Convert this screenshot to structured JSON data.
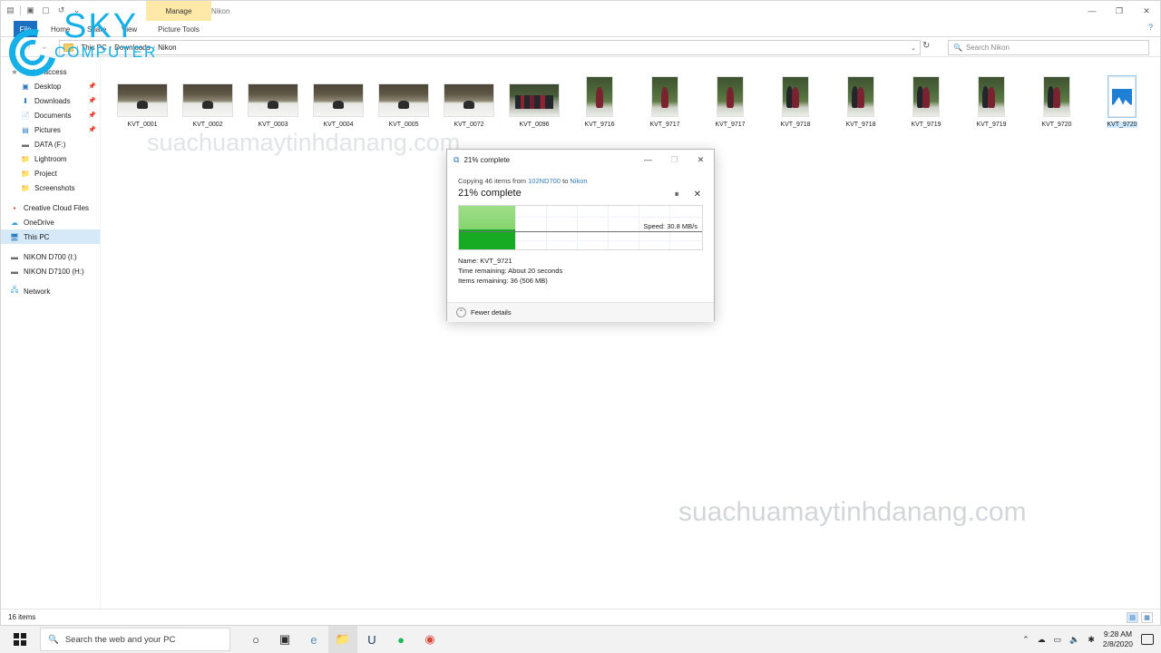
{
  "window": {
    "title": "Nikon",
    "contextual_tab": "Manage",
    "picture_tools_label": "Picture Tools",
    "quick_access_icons": [
      "explorer-icon",
      "properties-icon",
      "new-folder-icon",
      "undo-icon",
      "dropdown-icon"
    ],
    "controls": {
      "minimize": "—",
      "maximize": "❐",
      "close": "✕"
    },
    "help": "?"
  },
  "ribbon": {
    "tabs": [
      {
        "id": "file",
        "label": "File"
      },
      {
        "id": "home",
        "label": "Home"
      },
      {
        "id": "share",
        "label": "Share"
      },
      {
        "id": "view",
        "label": "View"
      },
      {
        "id": "pictools",
        "label": "Picture Tools"
      }
    ]
  },
  "address": {
    "back": "‹",
    "forward": "›",
    "up": "↑",
    "breadcrumb": [
      "This PC",
      "Downloads",
      "Nikon"
    ],
    "separator": "›",
    "dropdown": "⌄",
    "refresh": "↻"
  },
  "search": {
    "placeholder": "Search Nikon",
    "icon": "search-icon"
  },
  "sidebar": {
    "items": [
      {
        "label": "Quick access",
        "icon": "star-icon",
        "indent": 0,
        "pinned": false,
        "selected": false
      },
      {
        "label": "Desktop",
        "icon": "desktop-icon",
        "indent": 1,
        "pinned": true,
        "selected": false
      },
      {
        "label": "Downloads",
        "icon": "download-icon",
        "indent": 1,
        "pinned": true,
        "selected": false
      },
      {
        "label": "Documents",
        "icon": "document-icon",
        "indent": 1,
        "pinned": true,
        "selected": false
      },
      {
        "label": "Pictures",
        "icon": "pictures-icon",
        "indent": 1,
        "pinned": true,
        "selected": false
      },
      {
        "label": "DATA (F:)",
        "icon": "drive-icon",
        "indent": 1,
        "pinned": false,
        "selected": false
      },
      {
        "label": "Lightroom",
        "icon": "folder-icon",
        "indent": 1,
        "pinned": false,
        "selected": false
      },
      {
        "label": "Project",
        "icon": "folder-icon",
        "indent": 1,
        "pinned": false,
        "selected": false
      },
      {
        "label": "Screenshots",
        "icon": "folder-icon",
        "indent": 1,
        "pinned": false,
        "selected": false
      },
      {
        "label": "Creative Cloud Files",
        "icon": "creative-cloud-icon",
        "indent": 0,
        "pinned": false,
        "selected": false
      },
      {
        "label": "OneDrive",
        "icon": "onedrive-icon",
        "indent": 0,
        "pinned": false,
        "selected": false
      },
      {
        "label": "This PC",
        "icon": "this-pc-icon",
        "indent": 0,
        "pinned": false,
        "selected": true
      },
      {
        "label": "NIKON D700 (I:)",
        "icon": "drive-icon",
        "indent": 0,
        "pinned": false,
        "selected": false
      },
      {
        "label": "NIKON D7100 (H:)",
        "icon": "drive-icon",
        "indent": 0,
        "pinned": false,
        "selected": false
      },
      {
        "label": "Network",
        "icon": "network-icon",
        "indent": 0,
        "pinned": false,
        "selected": false
      }
    ]
  },
  "files": [
    {
      "name": "KVT_0001",
      "kind": "snow",
      "orient": "land",
      "selected": false
    },
    {
      "name": "KVT_0002",
      "kind": "snow",
      "orient": "land",
      "selected": false
    },
    {
      "name": "KVT_0003",
      "kind": "snow",
      "orient": "land",
      "selected": false
    },
    {
      "name": "KVT_0004",
      "kind": "snow",
      "orient": "land",
      "selected": false
    },
    {
      "name": "KVT_0005",
      "kind": "snow",
      "orient": "land",
      "selected": false
    },
    {
      "name": "KVT_0072",
      "kind": "snow",
      "orient": "land",
      "selected": false
    },
    {
      "name": "KVT_0096",
      "kind": "group",
      "orient": "land",
      "selected": false
    },
    {
      "name": "KVT_9716",
      "kind": "green",
      "orient": "port",
      "selected": false
    },
    {
      "name": "KVT_9717",
      "kind": "green",
      "orient": "port",
      "selected": false
    },
    {
      "name": "KVT_9717",
      "kind": "green",
      "orient": "port",
      "selected": false
    },
    {
      "name": "KVT_9718",
      "kind": "green2",
      "orient": "port",
      "selected": false
    },
    {
      "name": "KVT_9718",
      "kind": "green2",
      "orient": "port",
      "selected": false
    },
    {
      "name": "KVT_9719",
      "kind": "green2",
      "orient": "port",
      "selected": false
    },
    {
      "name": "KVT_9719",
      "kind": "green2",
      "orient": "port",
      "selected": false
    },
    {
      "name": "KVT_9720",
      "kind": "green2",
      "orient": "port",
      "selected": false
    },
    {
      "name": "KVT_9720",
      "kind": "placeholder",
      "orient": "port",
      "selected": true
    }
  ],
  "status": {
    "items_count": "16 items",
    "view_details_icon": "details-view-icon",
    "view_large_icon": "large-icons-view-icon"
  },
  "copy_dialog": {
    "title": "21% complete",
    "title_icon": "copy-icon",
    "minimize": "—",
    "maximize": "❐",
    "close": "✕",
    "summary_prefix": "Copying 46 items from ",
    "source": "102ND700",
    "summary_mid": " to ",
    "destination": "Nikon",
    "percent_complete": "21% complete",
    "pause_icon": "⏸",
    "cancel_icon": "✕",
    "speed_label": "Speed: 30.8 MB/s",
    "name_label": "Name:",
    "name_value": "KVT_9721",
    "time_label": "Time remaining:",
    "time_value": "About 20 seconds",
    "items_label": "Items remaining:",
    "items_value": "36 (506 MB)",
    "fewer_details": "Fewer details",
    "chevron": "⌃",
    "progress_percent": 21,
    "accent_green": "#16ab22",
    "accent_green_light": "#8fd97a"
  },
  "watermarks": {
    "top": "suachuamaytinhdanang.com",
    "bottom": "suachuamaytinhdanang.com"
  },
  "logo": {
    "top_text": "SKY",
    "bottom_text": "COMPUTER",
    "color": "#16b0e8"
  },
  "taskbar": {
    "start_icon": "windows-start-icon",
    "search_placeholder": "Search the web and your PC",
    "search_icon": "search-icon",
    "items": [
      {
        "name": "cortana-icon",
        "glyph": "○",
        "active": false
      },
      {
        "name": "task-view-icon",
        "glyph": "▣",
        "active": false
      },
      {
        "name": "edge-icon",
        "glyph": "e",
        "active": false
      },
      {
        "name": "file-explorer-icon",
        "glyph": "📁",
        "active": true
      },
      {
        "name": "ultraedit-icon",
        "glyph": "U",
        "active": false
      },
      {
        "name": "spotify-icon",
        "glyph": "●",
        "active": false
      },
      {
        "name": "chrome-icon",
        "glyph": "◉",
        "active": false
      }
    ],
    "tray": [
      {
        "name": "show-hidden-icons",
        "glyph": "⌃"
      },
      {
        "name": "onedrive-tray-icon",
        "glyph": "☁"
      },
      {
        "name": "network-tray-icon",
        "glyph": "▭"
      },
      {
        "name": "volume-tray-icon",
        "glyph": "🔈"
      },
      {
        "name": "bluetooth-tray-icon",
        "glyph": "✱"
      }
    ],
    "time": "9:28 AM",
    "date": "2/8/2020",
    "action_center_icon": "action-center-icon"
  }
}
